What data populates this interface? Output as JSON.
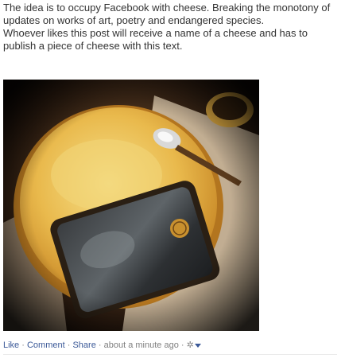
{
  "post": {
    "paragraphs": [
      "The idea is to occupy Facebook with cheese. Breaking the monotony of updates on works of art, poetry and endangered species.",
      "Whoever likes this post will receive a name of a cheese and has to publish a piece of cheese with this text."
    ],
    "photo_icon": "photo-cheese-wheel-tray-spoon"
  },
  "actions": {
    "like": "Like",
    "comment": "Comment",
    "share": "Share",
    "separator": "·",
    "timestamp": "about a minute ago",
    "settings_icon": "gear-icon",
    "dropdown_icon": "caret-down-icon"
  },
  "colors": {
    "link": "#3b5998",
    "meta": "#7f7f7f",
    "cheese": "#e7b84a"
  }
}
